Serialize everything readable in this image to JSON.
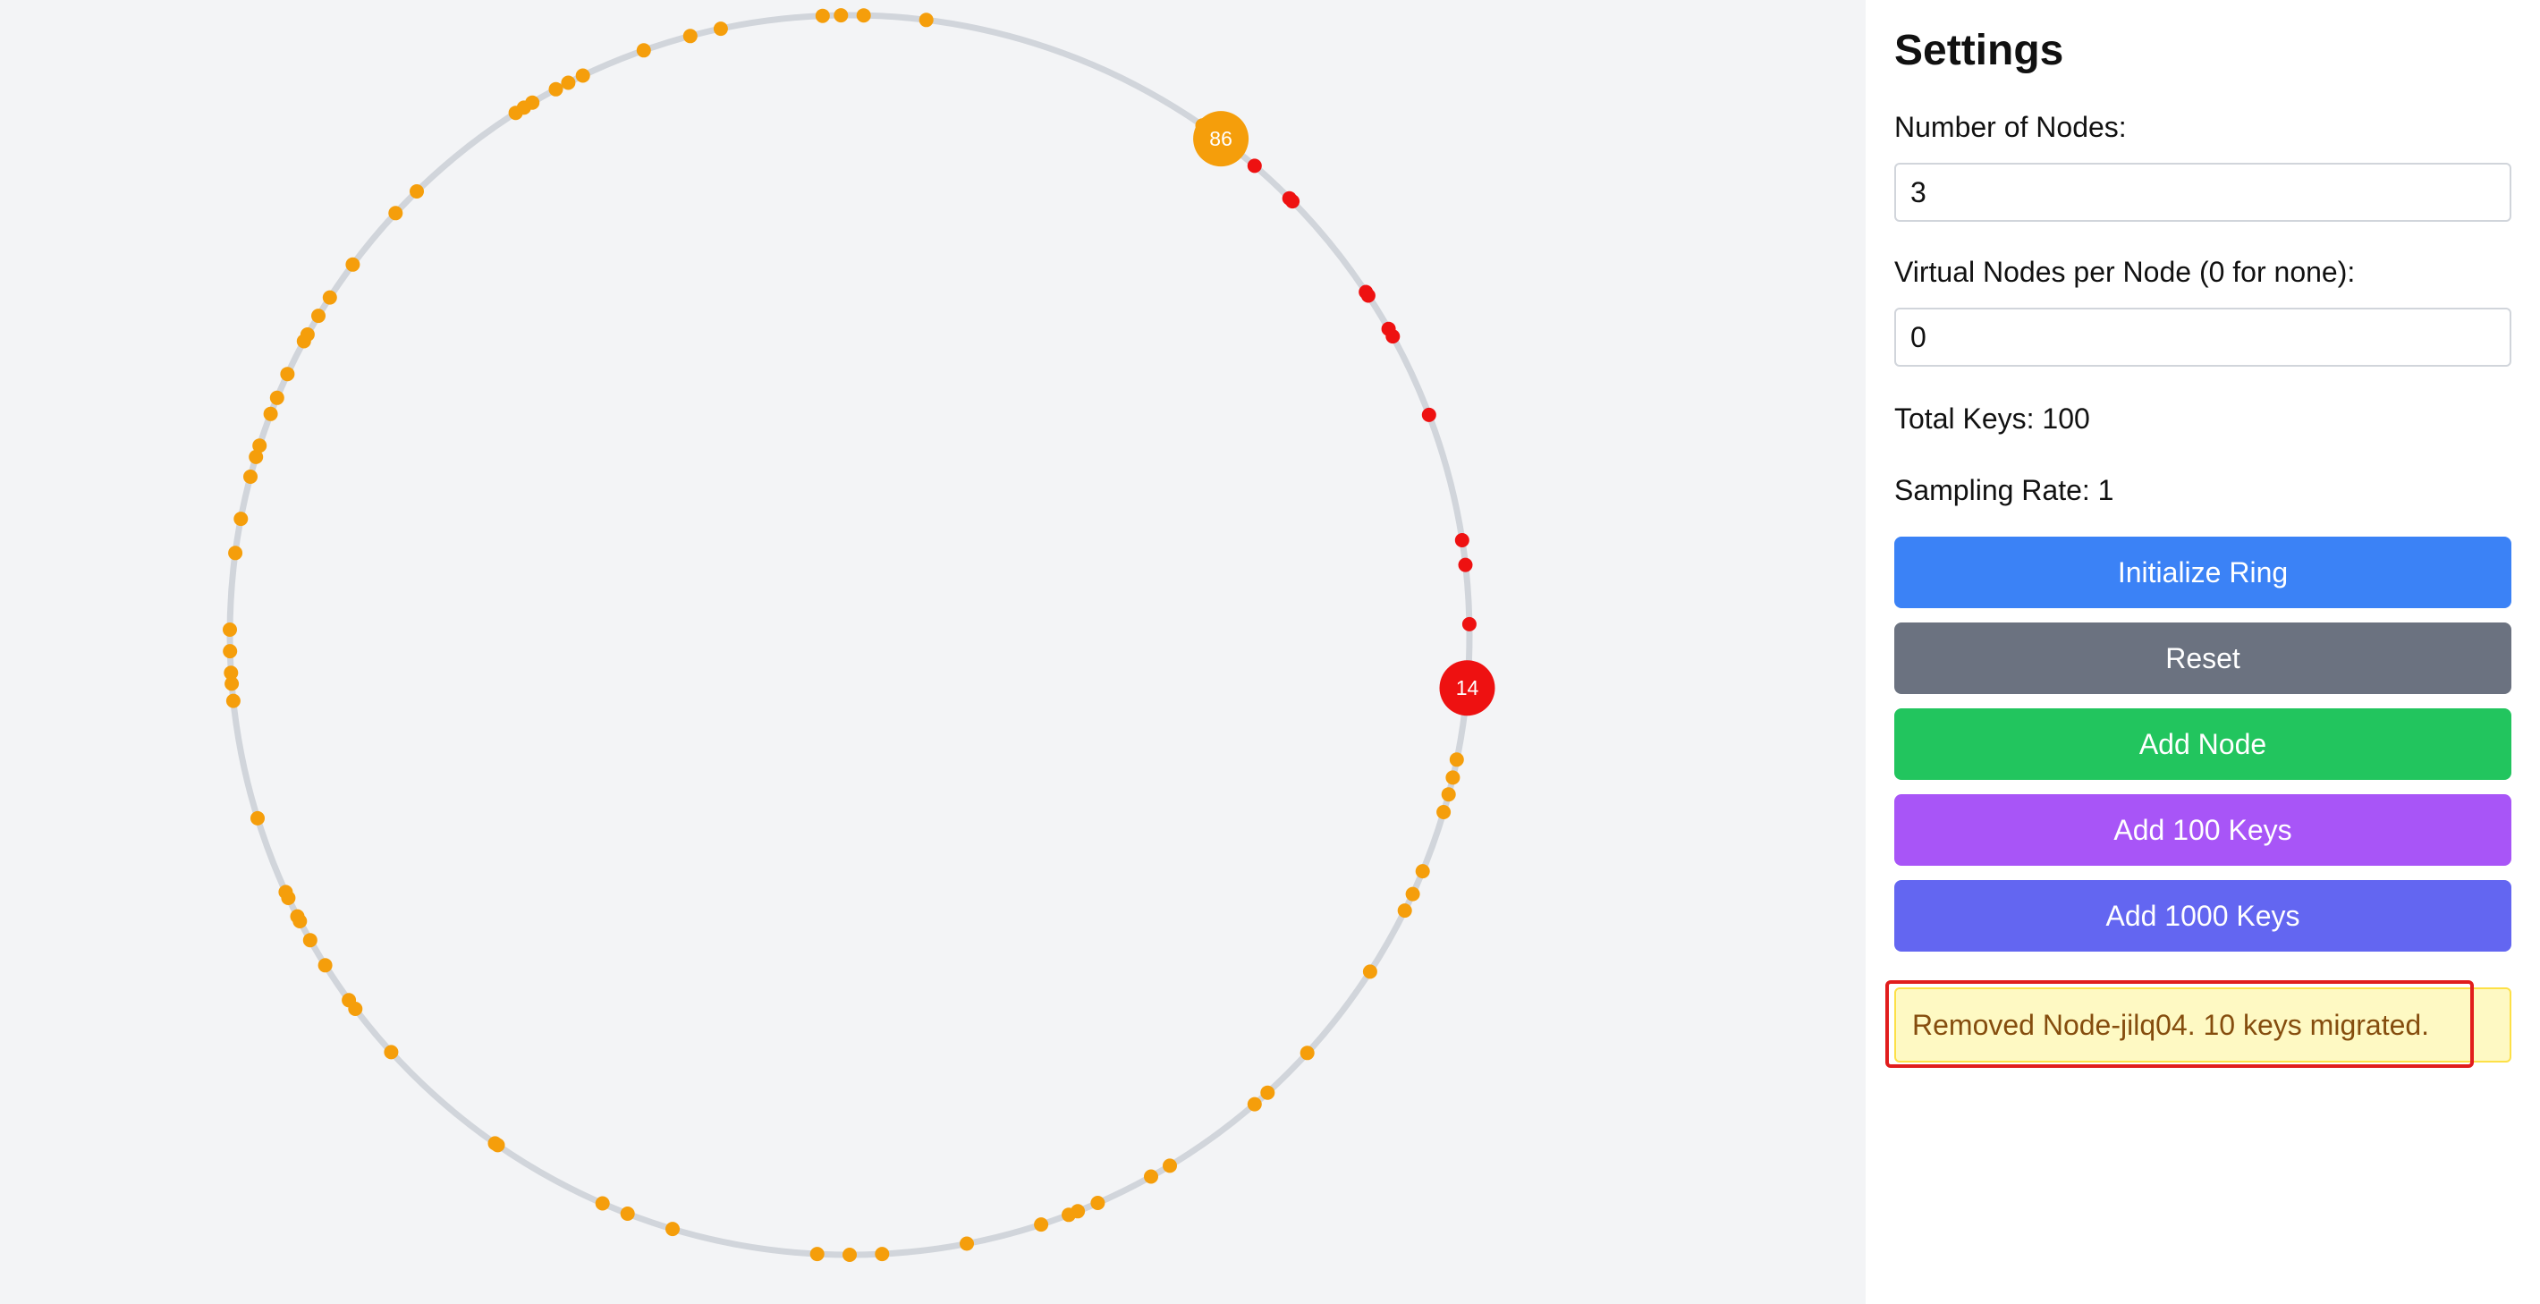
{
  "ring": {
    "track_color": "#d1d5db",
    "node_colors": {
      "orange": "#f59e0b",
      "red": "#ee1111"
    },
    "nodes": [
      {
        "label": "86",
        "angle_deg": 36.8,
        "color": "#f59e0b"
      },
      {
        "label": "14",
        "angle_deg": 94.9,
        "color": "#ee1111"
      }
    ],
    "keys": [
      {
        "angle_deg": -0.8,
        "color": "#f59e0b"
      },
      {
        "angle_deg": 1.3,
        "color": "#f59e0b"
      },
      {
        "angle_deg": 7.1,
        "color": "#f59e0b"
      },
      {
        "angle_deg": 34.7,
        "color": "#f59e0b"
      },
      {
        "angle_deg": 35.3,
        "color": "#f59e0b"
      },
      {
        "angle_deg": 36.0,
        "color": "#f59e0b"
      },
      {
        "angle_deg": 40.8,
        "color": "#ee1111"
      },
      {
        "angle_deg": 45.2,
        "color": "#ee1111"
      },
      {
        "angle_deg": 45.6,
        "color": "#ee1111"
      },
      {
        "angle_deg": 56.4,
        "color": "#ee1111"
      },
      {
        "angle_deg": 56.8,
        "color": "#ee1111"
      },
      {
        "angle_deg": 60.4,
        "color": "#ee1111"
      },
      {
        "angle_deg": 61.2,
        "color": "#ee1111"
      },
      {
        "angle_deg": 69.2,
        "color": "#ee1111"
      },
      {
        "angle_deg": 81.2,
        "color": "#ee1111"
      },
      {
        "angle_deg": 83.5,
        "color": "#ee1111"
      },
      {
        "angle_deg": 89.0,
        "color": "#ee1111"
      },
      {
        "angle_deg": 101.6,
        "color": "#f59e0b"
      },
      {
        "angle_deg": 103.3,
        "color": "#f59e0b"
      },
      {
        "angle_deg": 104.9,
        "color": "#f59e0b"
      },
      {
        "angle_deg": 106.6,
        "color": "#f59e0b"
      },
      {
        "angle_deg": 112.4,
        "color": "#f59e0b"
      },
      {
        "angle_deg": 114.7,
        "color": "#f59e0b"
      },
      {
        "angle_deg": 116.4,
        "color": "#f59e0b"
      },
      {
        "angle_deg": 122.9,
        "color": "#f59e0b"
      },
      {
        "angle_deg": 132.4,
        "color": "#f59e0b"
      },
      {
        "angle_deg": 137.6,
        "color": "#f59e0b"
      },
      {
        "angle_deg": 139.2,
        "color": "#f59e0b"
      },
      {
        "angle_deg": 148.9,
        "color": "#f59e0b"
      },
      {
        "angle_deg": 150.9,
        "color": "#f59e0b"
      },
      {
        "angle_deg": 156.4,
        "color": "#f59e0b"
      },
      {
        "angle_deg": 158.4,
        "color": "#f59e0b"
      },
      {
        "angle_deg": 159.3,
        "color": "#f59e0b"
      },
      {
        "angle_deg": 162.0,
        "color": "#f59e0b"
      },
      {
        "angle_deg": 169.1,
        "color": "#f59e0b"
      },
      {
        "angle_deg": 177.0,
        "color": "#f59e0b"
      },
      {
        "angle_deg": 180.0,
        "color": "#f59e0b"
      },
      {
        "angle_deg": 183.0,
        "color": "#f59e0b"
      },
      {
        "angle_deg": 196.6,
        "color": "#f59e0b"
      },
      {
        "angle_deg": 201.0,
        "color": "#f59e0b"
      },
      {
        "angle_deg": 203.5,
        "color": "#f59e0b"
      },
      {
        "angle_deg": 214.6,
        "color": "#f59e0b"
      },
      {
        "angle_deg": 214.9,
        "color": "#f59e0b"
      },
      {
        "angle_deg": 227.7,
        "color": "#f59e0b"
      },
      {
        "angle_deg": 232.9,
        "color": "#f59e0b"
      },
      {
        "angle_deg": 233.9,
        "color": "#f59e0b"
      },
      {
        "angle_deg": 237.8,
        "color": "#f59e0b"
      },
      {
        "angle_deg": 240.5,
        "color": "#f59e0b"
      },
      {
        "angle_deg": 242.5,
        "color": "#f59e0b"
      },
      {
        "angle_deg": 243.0,
        "color": "#f59e0b"
      },
      {
        "angle_deg": 244.9,
        "color": "#f59e0b"
      },
      {
        "angle_deg": 245.5,
        "color": "#f59e0b"
      },
      {
        "angle_deg": 252.8,
        "color": "#f59e0b"
      },
      {
        "angle_deg": 263.9,
        "color": "#f59e0b"
      },
      {
        "angle_deg": 265.5,
        "color": "#f59e0b"
      },
      {
        "angle_deg": 266.5,
        "color": "#f59e0b"
      },
      {
        "angle_deg": 268.5,
        "color": "#f59e0b"
      },
      {
        "angle_deg": 270.5,
        "color": "#f59e0b"
      },
      {
        "angle_deg": 277.6,
        "color": "#f59e0b"
      },
      {
        "angle_deg": 280.8,
        "color": "#f59e0b"
      },
      {
        "angle_deg": 284.8,
        "color": "#f59e0b"
      },
      {
        "angle_deg": 286.7,
        "color": "#f59e0b"
      },
      {
        "angle_deg": 287.8,
        "color": "#f59e0b"
      },
      {
        "angle_deg": 290.9,
        "color": "#f59e0b"
      },
      {
        "angle_deg": 292.5,
        "color": "#f59e0b"
      },
      {
        "angle_deg": 294.9,
        "color": "#f59e0b"
      },
      {
        "angle_deg": 298.3,
        "color": "#f59e0b"
      },
      {
        "angle_deg": 299.0,
        "color": "#f59e0b"
      },
      {
        "angle_deg": 301.0,
        "color": "#f59e0b"
      },
      {
        "angle_deg": 303.0,
        "color": "#f59e0b"
      },
      {
        "angle_deg": 306.7,
        "color": "#f59e0b"
      },
      {
        "angle_deg": 312.9,
        "color": "#f59e0b"
      },
      {
        "angle_deg": 315.7,
        "color": "#f59e0b"
      },
      {
        "angle_deg": 327.4,
        "color": "#f59e0b"
      },
      {
        "angle_deg": 328.3,
        "color": "#f59e0b"
      },
      {
        "angle_deg": 329.2,
        "color": "#f59e0b"
      },
      {
        "angle_deg": 331.7,
        "color": "#f59e0b"
      },
      {
        "angle_deg": 333.0,
        "color": "#f59e0b"
      },
      {
        "angle_deg": 334.5,
        "color": "#f59e0b"
      },
      {
        "angle_deg": 340.6,
        "color": "#f59e0b"
      },
      {
        "angle_deg": 345.1,
        "color": "#f59e0b"
      },
      {
        "angle_deg": 348.0,
        "color": "#f59e0b"
      },
      {
        "angle_deg": 357.5,
        "color": "#f59e0b"
      }
    ]
  },
  "settings": {
    "title": "Settings",
    "num_nodes_label": "Number of Nodes:",
    "num_nodes_value": "3",
    "virtual_nodes_label": "Virtual Nodes per Node (0 for none):",
    "virtual_nodes_value": "0",
    "total_keys": "Total Keys: 100",
    "sampling_rate": "Sampling Rate: 1",
    "buttons": {
      "initialize": "Initialize Ring",
      "reset": "Reset",
      "add_node": "Add Node",
      "add_100": "Add 100 Keys",
      "add_1000": "Add 1000 Keys"
    },
    "button_colors": {
      "initialize": "#3b82f6",
      "reset": "#6b7280",
      "add_node": "#22c55e",
      "add_100": "#a855f7",
      "add_1000": "#6366f1"
    },
    "toast": "Removed Node-jilq04. 10 keys migrated."
  }
}
